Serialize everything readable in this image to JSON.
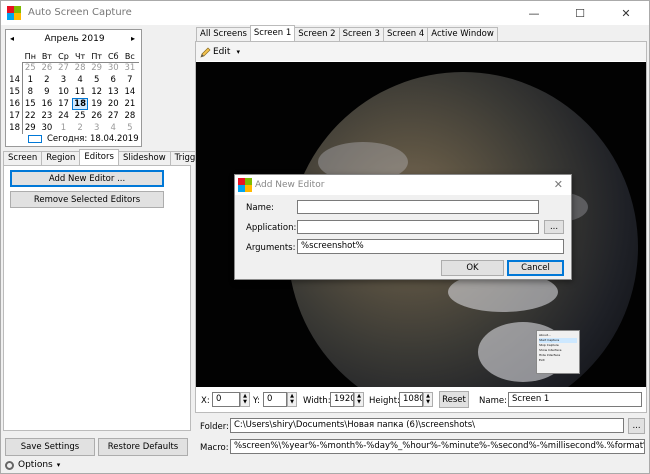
{
  "app": {
    "title": "Auto Screen Capture",
    "minimize": "—",
    "maximize": "☐",
    "close": "✕"
  },
  "calendar": {
    "prev": "◂",
    "next": "▸",
    "month": "Апрель 2019",
    "weekdays": [
      "Пн",
      "Вт",
      "Ср",
      "Чт",
      "Пт",
      "Сб",
      "Вс"
    ],
    "weeks": [
      {
        "num": "",
        "days": [
          "25",
          "26",
          "27",
          "28",
          "29",
          "30",
          "31"
        ]
      },
      {
        "num": "14",
        "days": [
          "1",
          "2",
          "3",
          "4",
          "5",
          "6",
          "7"
        ]
      },
      {
        "num": "15",
        "days": [
          "8",
          "9",
          "10",
          "11",
          "12",
          "13",
          "14"
        ]
      },
      {
        "num": "16",
        "days": [
          "15",
          "16",
          "17",
          "18",
          "19",
          "20",
          "21"
        ]
      },
      {
        "num": "17",
        "days": [
          "22",
          "23",
          "24",
          "25",
          "26",
          "27",
          "28"
        ]
      },
      {
        "num": "18",
        "days": [
          "29",
          "30",
          "1",
          "2",
          "3",
          "4",
          "5"
        ]
      }
    ],
    "today_label": "Сегодня: 18.04.2019"
  },
  "left_tabs": [
    "Screen",
    "Region",
    "Editors",
    "Slideshow",
    "Triggers"
  ],
  "editors": {
    "add_button": "Add New Editor ...",
    "remove_button": "Remove Selected Editors"
  },
  "bottom_left": {
    "save_settings": "Save Settings",
    "restore_defaults": "Restore Defaults",
    "options": "Options",
    "options_caret": "▾"
  },
  "right_tabs": [
    "All Screens",
    "Screen 1",
    "Screen 2",
    "Screen 3",
    "Screen 4",
    "Active Window"
  ],
  "toolbar": {
    "edit_label": "Edit",
    "edit_caret": "▾"
  },
  "preview": {
    "context_menu": [
      "About...",
      "Start Capture",
      "Stop Capture",
      "Show Interface",
      "Hide Interface",
      "Exit"
    ]
  },
  "screen_fields": {
    "x_label": "X:",
    "x_value": "0",
    "y_label": "Y:",
    "y_value": "0",
    "width_label": "Width:",
    "width_value": "1920",
    "height_label": "Height:",
    "height_value": "1080",
    "reset_label": "Reset",
    "name_label": "Name:",
    "name_value": "Screen 1"
  },
  "folder": {
    "label": "Folder:",
    "value": "C:\\Users\\shiry\\Documents\\Новая папка (6)\\screenshots\\",
    "browse": "..."
  },
  "macro": {
    "label": "Macro:",
    "value": "%screen%\\%year%-%month%-%day%_%hour%-%minute%-%second%-%millisecond%.%format%"
  },
  "dialog": {
    "title": "Add New Editor",
    "close": "✕",
    "name_label": "Name:",
    "name_value": "",
    "application_label": "Application:",
    "application_value": "",
    "browse": "...",
    "arguments_label": "Arguments:",
    "arguments_value": "%screenshot%",
    "ok": "OK",
    "cancel": "Cancel"
  },
  "colors": {
    "accent": "#0078d7",
    "window_bg": "#f0f0f0",
    "button_bg": "#e1e1e1"
  }
}
